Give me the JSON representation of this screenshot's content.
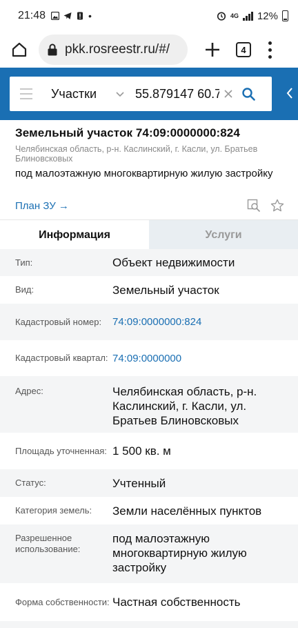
{
  "status_bar": {
    "time": "21:48",
    "network": "4G",
    "battery": "12%"
  },
  "browser": {
    "url": "pkk.rosreestr.ru/#/",
    "tab_count": "4"
  },
  "search": {
    "category": "Участки",
    "query": "55.879147 60.7"
  },
  "object": {
    "title": "Земельный участок 74:09:0000000:824",
    "address": "Челябинская область, р-н. Каслинский, г. Касли, ул. Братьев Блиновсковых",
    "purpose": "под малоэтажную многоквартирную жилую застройку",
    "plan_link": "План ЗУ →"
  },
  "tabs": [
    {
      "label": "Информация"
    },
    {
      "label": "Услуги"
    }
  ],
  "info": [
    {
      "label": "Тип:",
      "value": "Объект недвижимости"
    },
    {
      "label": "Вид:",
      "value": "Земельный участок"
    },
    {
      "label": "Кадастровый номер:",
      "value": "74:09:0000000:824"
    },
    {
      "label": "Кадастровый квартал:",
      "value": "74:09:0000000"
    },
    {
      "label": "Адрес:",
      "value": "Челябинская область, р-н. Каслинский, г. Касли, ул. Братьев Блиновсковых"
    },
    {
      "label": "Площадь уточненная:",
      "value": "1 500 кв. м"
    },
    {
      "label": "Статус:",
      "value": "Учтенный"
    },
    {
      "label": "Категория земель:",
      "value": "Земли населённых пунктов"
    },
    {
      "label": "Разрешенное использование:",
      "value": "под малоэтажную многоквартирную жилую застройку"
    },
    {
      "label": "Форма собственности:",
      "value": "Частная собственность"
    }
  ],
  "colors": {
    "accent": "#1a6fb3",
    "inactive_tab_bg": "#e9eef2",
    "row_alt_bg": "#f4f5f6"
  }
}
